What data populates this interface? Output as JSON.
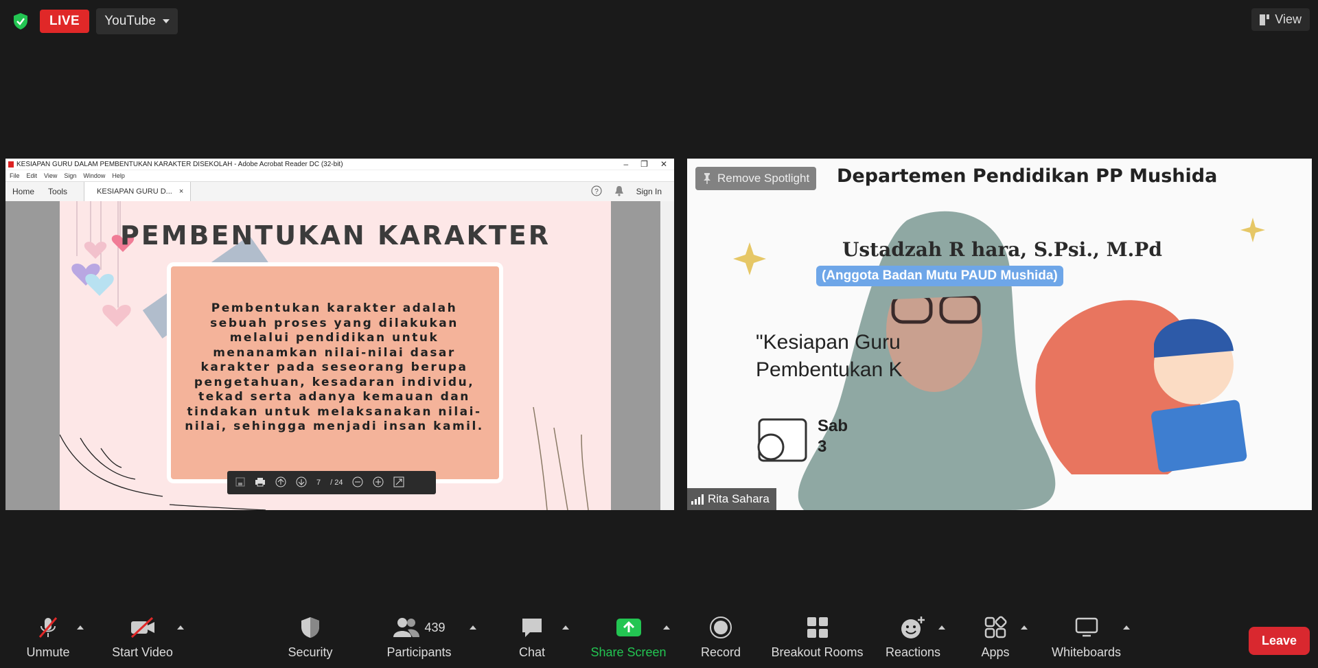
{
  "topbar": {
    "live_label": "LIVE",
    "stream_target": "YouTube",
    "view_label": "View"
  },
  "share": {
    "window_title": "KESIAPAN GURU DALAM PEMBENTUKAN KARAKTER DISEKOLAH - Adobe Acrobat Reader DC (32-bit)",
    "menu": [
      "File",
      "Edit",
      "View",
      "Sign",
      "Window",
      "Help"
    ],
    "tabs": {
      "home": "Home",
      "tools": "Tools",
      "doc": "KESIAPAN GURU D...",
      "doc_close": "×"
    },
    "sign_in": "Sign In",
    "slide_title": "PEMBENTUKAN KARAKTER",
    "slide_body": "Pembentukan karakter adalah sebuah proses yang dilakukan melalui pendidikan untuk menanamkan nilai-nilai dasar karakter pada seseorang berupa pengetahuan, kesadaran individu, tekad serta adanya kemauan dan tindakan untuk melaksanakan nilai-nilai, sehingga menjadi insan kamil.",
    "page_current": "7",
    "page_total": "/ 24"
  },
  "speaker": {
    "remove_spotlight": "Remove Spotlight",
    "department": "Departemen Pendidikan PP Mushida",
    "ustadzah": "Ustadzah R  hara, S.Psi., M.Pd",
    "role": "(Anggota Badan            Mutu PAUD Mushida)",
    "topic_line1": "\"Kesiapan Guru",
    "topic_line2": "Pembentukan K",
    "date_line1": "Sab",
    "date_line2": "3",
    "name": "Rita Sahara"
  },
  "toolbar": {
    "unmute": "Unmute",
    "start_video": "Start Video",
    "security": "Security",
    "participants": "Participants",
    "participant_count": "439",
    "chat": "Chat",
    "share_screen": "Share Screen",
    "record": "Record",
    "breakout_rooms": "Breakout Rooms",
    "reactions": "Reactions",
    "apps": "Apps",
    "whiteboards": "Whiteboards",
    "leave": "Leave"
  },
  "colors": {
    "background": "#1a1a1a",
    "live": "#e02828",
    "share_screen_green": "#23c552",
    "leave_red": "#d9282f",
    "shield_green": "#23c552"
  }
}
